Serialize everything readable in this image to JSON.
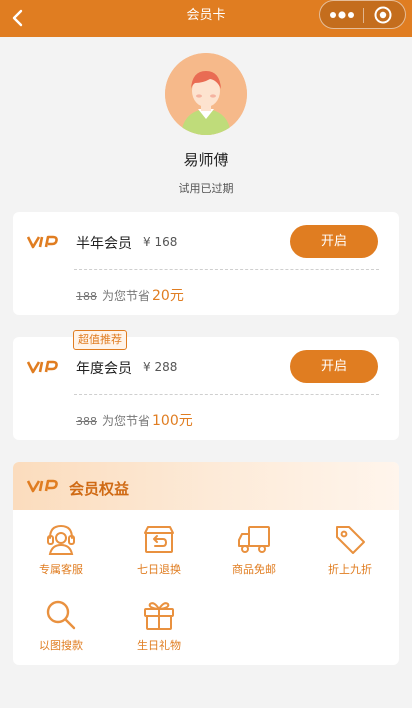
{
  "header": {
    "title": "会员卡"
  },
  "profile": {
    "name": "易师傅",
    "status": "试用已过期"
  },
  "plans": [
    {
      "name": "半年会员",
      "price": "¥ 168",
      "button": "开启",
      "original": "188",
      "save_text": "为您节省",
      "save_amount": "20元"
    },
    {
      "name": "年度会员",
      "price": "¥ 288",
      "button": "开启",
      "original": "388",
      "save_text": "为您节省",
      "save_amount": "100元",
      "badge": "超值推荐"
    }
  ],
  "benefits": {
    "title": "会员权益",
    "items": [
      {
        "label": "专属客服",
        "icon": "headset-icon"
      },
      {
        "label": "七日退换",
        "icon": "return-box-icon"
      },
      {
        "label": "商品免邮",
        "icon": "truck-icon"
      },
      {
        "label": "折上九折",
        "icon": "tag-icon"
      },
      {
        "label": "以图搜款",
        "icon": "search-icon"
      },
      {
        "label": "生日礼物",
        "icon": "gift-icon"
      }
    ]
  },
  "colors": {
    "accent": "#e07d21",
    "background": "#f3f3f3"
  }
}
